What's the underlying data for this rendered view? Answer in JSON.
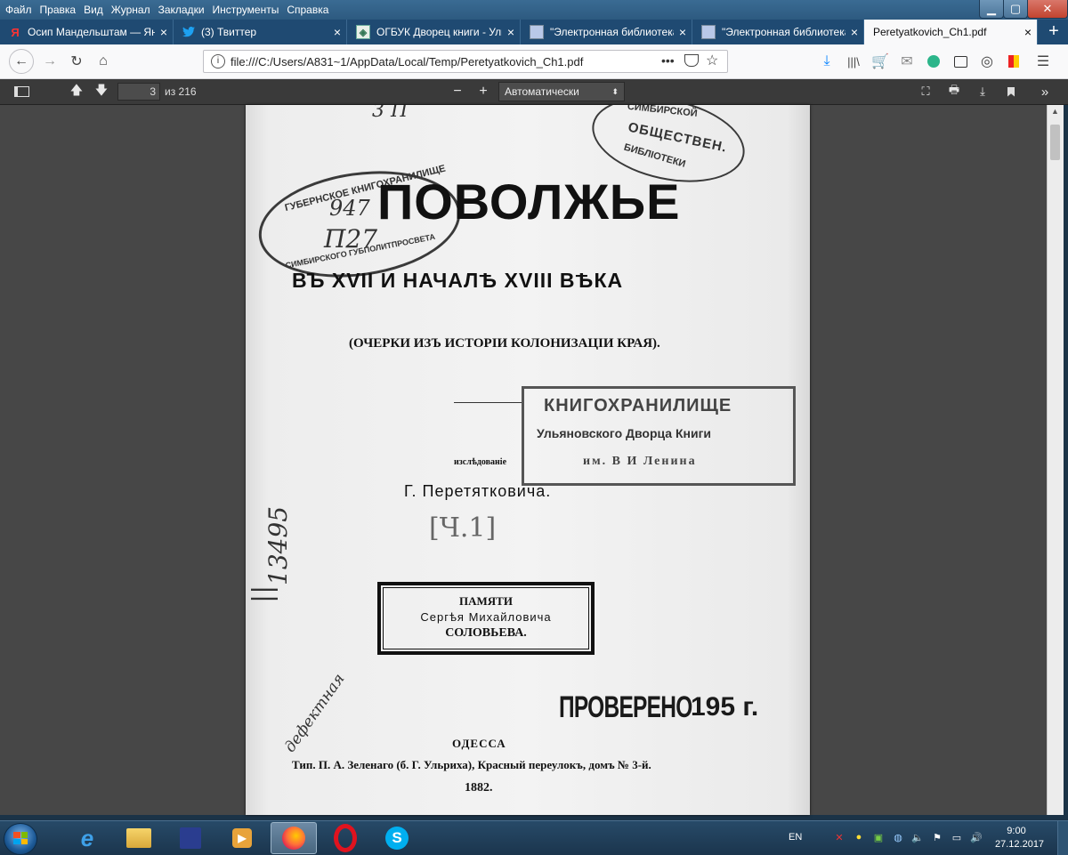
{
  "menubar": {
    "items": [
      "Файл",
      "Правка",
      "Вид",
      "Журнал",
      "Закладки",
      "Инструменты",
      "Справка"
    ]
  },
  "tabs": [
    {
      "title": "Осип Мандельштам — Янд",
      "icon": "yandex-icon",
      "active": false
    },
    {
      "title": "(3) Твиттер",
      "icon": "twitter-icon",
      "active": false
    },
    {
      "title": "ОГБУК Дворец книги - Уль",
      "icon": "site-icon",
      "active": false
    },
    {
      "title": "\"Электронная библиотека",
      "icon": "library-icon",
      "active": false
    },
    {
      "title": "\"Электронная библиотека",
      "icon": "library-icon",
      "active": false
    },
    {
      "title": "Peretyatkovich_Ch1.pdf",
      "icon": "",
      "active": true
    }
  ],
  "navbar": {
    "url": "file:///C:/Users/A831~1/AppData/Local/Temp/Peretyatkovich_Ch1.pdf"
  },
  "pdf": {
    "page_number": "3",
    "page_count": "из 216",
    "zoom": "Автоматически"
  },
  "document": {
    "title": "ПОВОЛЖЬЕ",
    "subtitle": "ВЪ XVII И НАЧАЛѢ XVIII ВѢКА",
    "series": "(ОЧЕРКИ ИЗЪ ИСТОРІИ КОЛОНИЗАЦІИ КРАЯ).",
    "study_label": "изслѣдованіе",
    "author": "Г. Перетятковича.",
    "shelfmark": "[Ч.1]",
    "dedication_line1": "ПАМЯТИ",
    "dedication_line2": "Сергѣя Михайловича",
    "dedication_line3": "СОЛОВЬЕВА.",
    "city": "ОДЕССА",
    "printer": "Тип. П. А. Зеленаго (б. Г. Ульриха), Красный переулокъ, домъ № 3-й.",
    "year": "1882.",
    "stamp_rect_line1": "КНИГОХРАНИЛИЩЕ",
    "stamp_rect_line2": "Ульяновского Дворца Книги",
    "stamp_rect_line3": "им. В И Ленина",
    "stamp_checked": "ПРОВЕРЕНО",
    "stamp_checked_year": "195 г.",
    "stamp_oval_left_top": "ГУБЕРНСКОЕ КНИГОХРАНИЛИЩЕ",
    "stamp_oval_left_bottom": "СИМБИРСКОГО ГУБПОЛИТПРОСВЕТА",
    "stamp_oval_right_top": "СИМБИРСКОЙ",
    "stamp_oval_right_mid": "ОБЩЕСТВЕН.",
    "stamp_oval_right_bottom": "БИБЛІОТЕКИ",
    "hand_number": "947",
    "hand_code": "П27",
    "hand_side_number": "13495",
    "hand_note": "дефектная",
    "hand_top": "3 П"
  },
  "taskbar": {
    "language": "EN",
    "time": "9:00",
    "date": "27.12.2017"
  }
}
